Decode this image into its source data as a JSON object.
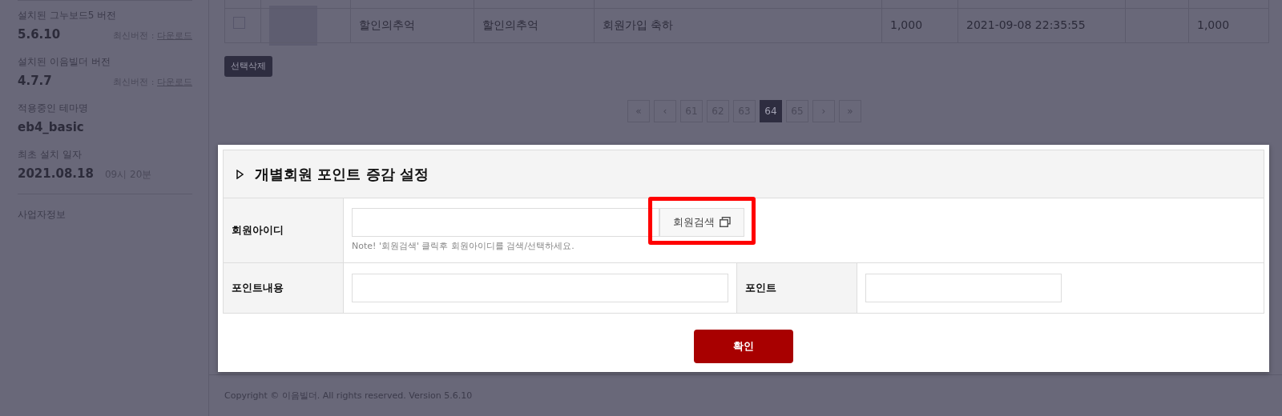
{
  "sidebar": {
    "items": [
      {
        "label": "설치된 그누보드5 버전",
        "value": "5.6.10",
        "note": "최신버전 :",
        "link": "다운로드"
      },
      {
        "label": "설치된 이음빌더 버전",
        "value": "4.7.7",
        "note": "최신버전 :",
        "link": "다운로드"
      },
      {
        "label": "적용중인 테마명",
        "value": "eb4_basic"
      },
      {
        "label": "최초 설치 일자",
        "value": "2021.08.18",
        "time": "09시 20분"
      }
    ],
    "footer_link": "사업자정보"
  },
  "table": {
    "rows": [
      {
        "checked": false,
        "cells": [
          {
            "text": "할인의추억"
          },
          {
            "text": "할인의추억"
          },
          {
            "text": "회원가입 축하"
          },
          {
            "text": "1,000"
          },
          {
            "text": "2021-09-08 22:35:55"
          },
          {},
          {
            "text": "1,000"
          }
        ]
      }
    ]
  },
  "delete_button": "선택삭제",
  "pagination": [
    {
      "label": "«",
      "selected": false
    },
    {
      "label": "‹",
      "selected": false
    },
    {
      "label": "61",
      "selected": false
    },
    {
      "label": "62",
      "selected": false
    },
    {
      "label": "63",
      "selected": false
    },
    {
      "label": "64",
      "selected": true
    },
    {
      "label": "65",
      "selected": false
    },
    {
      "label": "›",
      "selected": false
    },
    {
      "label": "»",
      "selected": false
    }
  ],
  "modal": {
    "title": "개별회원 포인트 증감 설정",
    "member_label": "회원아이디",
    "search_button": {
      "label": "회원검색",
      "highlighted": true
    },
    "note": "Note! '회원검색' 클릭후 회원아이디를 검색/선택하세요.",
    "content_label": "포인트내용",
    "point_label": "포인트",
    "confirm": "확인"
  },
  "footer": "Copyright © 이음빌더. All rights reserved. Version 5.6.10"
}
